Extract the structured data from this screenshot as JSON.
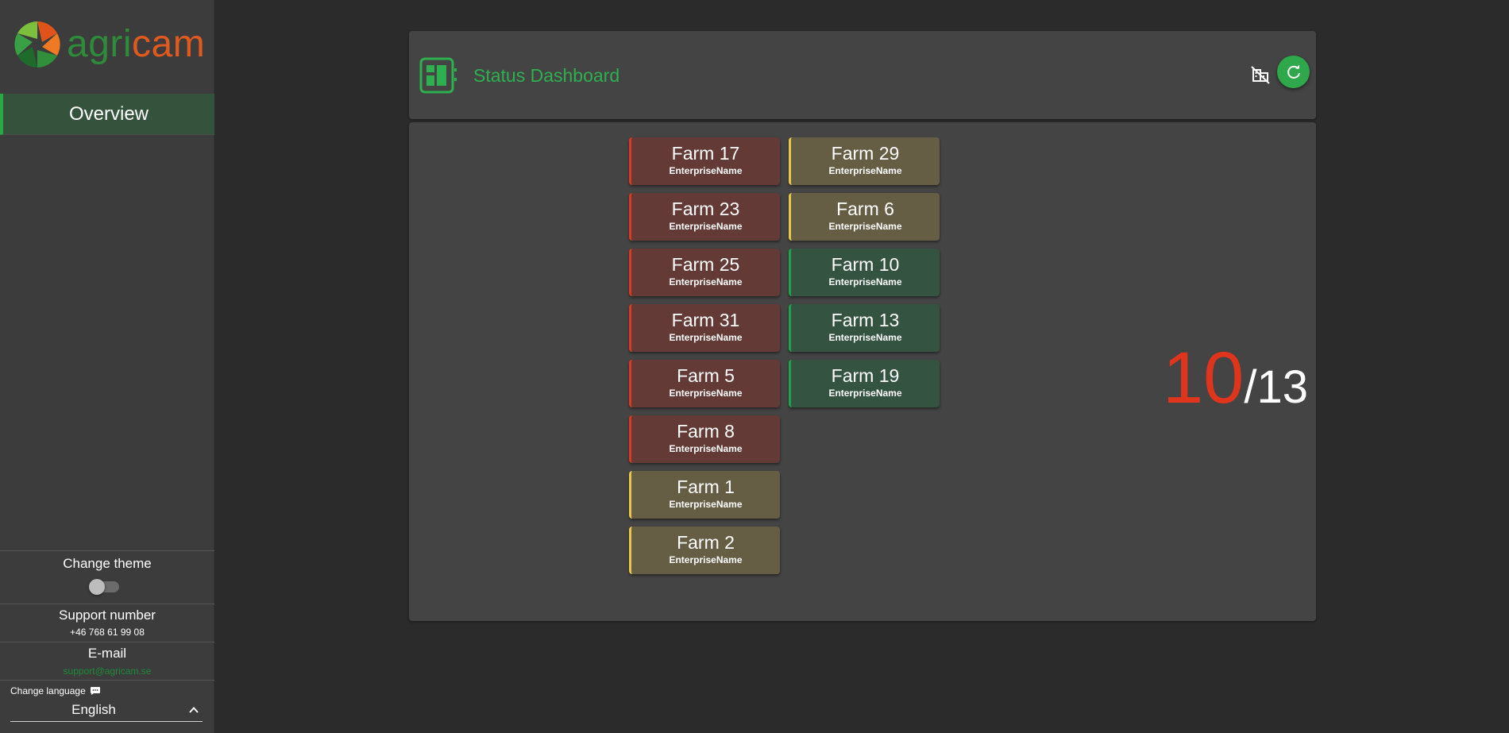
{
  "sidebar": {
    "logo": {
      "text_agri": "agri",
      "text_cam": "cam"
    },
    "nav": [
      {
        "label": "Overview",
        "active": true
      }
    ],
    "theme": {
      "label": "Change theme",
      "dark_mode_on": false
    },
    "support": {
      "label": "Support number",
      "value": "+46 768 61 99 08"
    },
    "email": {
      "label": "E-mail",
      "value": "support@agricam.se"
    },
    "language": {
      "label": "Change language",
      "value": "English"
    }
  },
  "header": {
    "title": "Status Dashboard",
    "icons": [
      "dashboard-icon",
      "no-building-icon",
      "refresh-icon"
    ]
  },
  "colors": {
    "accent": "#2eb050",
    "alert_red": "#d93b22",
    "warn_yellow": "#e8c84a",
    "ok_green": "#1fa24a"
  },
  "farms": {
    "column1": [
      {
        "name": "Farm 17",
        "enterprise": "EnterpriseName",
        "status": "red"
      },
      {
        "name": "Farm 23",
        "enterprise": "EnterpriseName",
        "status": "red"
      },
      {
        "name": "Farm 25",
        "enterprise": "EnterpriseName",
        "status": "red"
      },
      {
        "name": "Farm 31",
        "enterprise": "EnterpriseName",
        "status": "red"
      },
      {
        "name": "Farm 5",
        "enterprise": "EnterpriseName",
        "status": "red"
      },
      {
        "name": "Farm 8",
        "enterprise": "EnterpriseName",
        "status": "red"
      },
      {
        "name": "Farm 1",
        "enterprise": "EnterpriseName",
        "status": "yellow"
      },
      {
        "name": "Farm 2",
        "enterprise": "EnterpriseName",
        "status": "yellow"
      }
    ],
    "column2": [
      {
        "name": "Farm 29",
        "enterprise": "EnterpriseName",
        "status": "yellow"
      },
      {
        "name": "Farm 6",
        "enterprise": "EnterpriseName",
        "status": "yellow"
      },
      {
        "name": "Farm 10",
        "enterprise": "EnterpriseName",
        "status": "green"
      },
      {
        "name": "Farm 13",
        "enterprise": "EnterpriseName",
        "status": "green"
      },
      {
        "name": "Farm 19",
        "enterprise": "EnterpriseName",
        "status": "green"
      }
    ]
  },
  "counter": {
    "count": "10",
    "total": "/13"
  }
}
